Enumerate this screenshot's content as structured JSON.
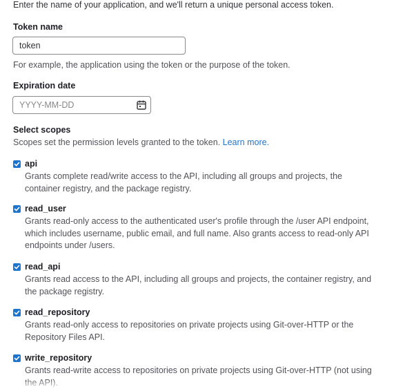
{
  "intro_text": "Enter the name of your application, and we'll return a unique personal access token.",
  "token_name": {
    "label": "Token name",
    "value": "token",
    "help": "For example, the application using the token or the purpose of the token."
  },
  "expiration": {
    "label": "Expiration date",
    "placeholder": "YYYY-MM-DD",
    "icon": "calendar-icon"
  },
  "scopes": {
    "label": "Select scopes",
    "help_prefix": "Scopes set the permission levels granted to the token.",
    "learn_more": "Learn more.",
    "checkbox_color": "#1f75cb",
    "items": [
      {
        "name": "api",
        "checked": true,
        "description": "Grants complete read/write access to the API, including all groups and projects, the container registry, and the package registry."
      },
      {
        "name": "read_user",
        "checked": true,
        "description": "Grants read-only access to the authenticated user's profile through the /user API endpoint, which includes username, public email, and full name. Also grants access to read-only API endpoints under /users."
      },
      {
        "name": "read_api",
        "checked": true,
        "description": "Grants read access to the API, including all groups and projects, the container registry, and the package registry."
      },
      {
        "name": "read_repository",
        "checked": true,
        "description": "Grants read-only access to repositories on private projects using Git-over-HTTP or the Repository Files API."
      },
      {
        "name": "write_repository",
        "checked": true,
        "description": "Grants read-write access to repositories on private projects using Git-over-HTTP (not using the API)."
      }
    ]
  }
}
